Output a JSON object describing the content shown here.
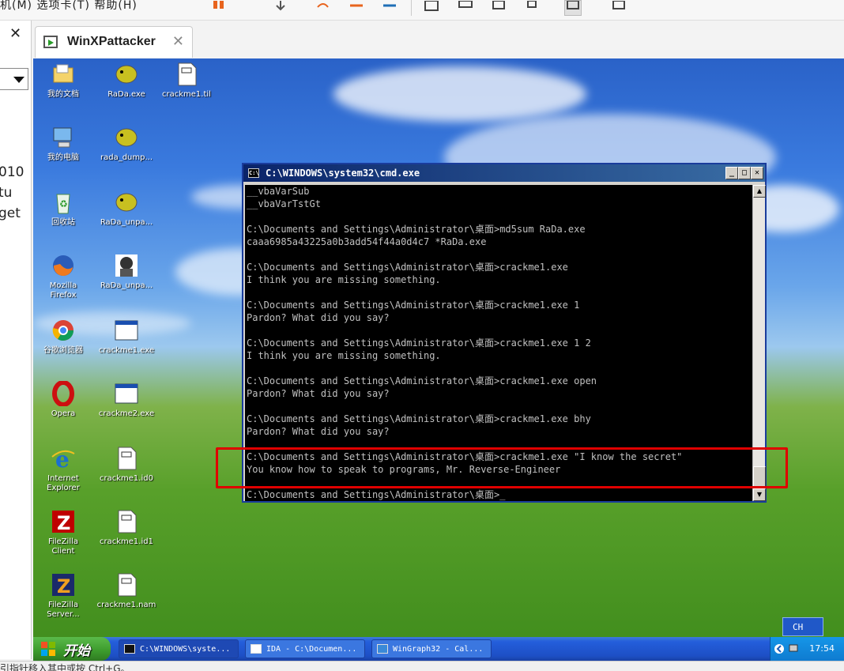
{
  "host": {
    "menu_text": "机(M)   选项卡(T)   帮助(H)",
    "clipped_side_text": [
      "010",
      "tu",
      "get"
    ],
    "bottom_text": "引指针移入其中或按 Ctrl+G。"
  },
  "vm_tab": {
    "label": "WinXPattacker"
  },
  "desktop_icons": [
    {
      "label": "我的文档",
      "icon": "my-documents-icon"
    },
    {
      "label": "RaDa.exe",
      "icon": "pufferfish-icon"
    },
    {
      "label": "crackme1.til",
      "icon": "file-icon"
    },
    {
      "label": "我的电脑",
      "icon": "my-computer-icon"
    },
    {
      "label": "rada_dump...",
      "icon": "pufferfish-icon"
    },
    {
      "label": "回收站",
      "icon": "recycle-bin-icon"
    },
    {
      "label": "RaDa_unpa...",
      "icon": "pufferfish-icon"
    },
    {
      "label": "Mozilla\nFirefox",
      "icon": "firefox-icon"
    },
    {
      "label": "RaDa_unpa...",
      "icon": "ida-portrait-icon"
    },
    {
      "label": "谷歌浏览器",
      "icon": "chrome-icon"
    },
    {
      "label": "crackme1.exe",
      "icon": "window-app-icon"
    },
    {
      "label": "Opera",
      "icon": "opera-icon"
    },
    {
      "label": "crackme2.exe",
      "icon": "window-app-icon"
    },
    {
      "label": "Internet\nExplorer",
      "icon": "ie-icon"
    },
    {
      "label": "crackme1.id0",
      "icon": "file-icon"
    },
    {
      "label": "FileZilla\nClient",
      "icon": "filezilla-icon"
    },
    {
      "label": "crackme1.id1",
      "icon": "file-icon"
    },
    {
      "label": "FileZilla\nServer...",
      "icon": "filezilla-server-icon"
    },
    {
      "label": "crackme1.nam",
      "icon": "file-icon"
    }
  ],
  "cmd": {
    "title": "C:\\WINDOWS\\system32\\cmd.exe",
    "lines": [
      "__vbaVarSub",
      "__vbaVarTstGt",
      "",
      "C:\\Documents and Settings\\Administrator\\桌面>md5sum RaDa.exe",
      "caaa6985a43225a0b3add54f44a0d4c7 *RaDa.exe",
      "",
      "C:\\Documents and Settings\\Administrator\\桌面>crackme1.exe",
      "I think you are missing something.",
      "",
      "C:\\Documents and Settings\\Administrator\\桌面>crackme1.exe 1",
      "Pardon? What did you say?",
      "",
      "C:\\Documents and Settings\\Administrator\\桌面>crackme1.exe 1 2",
      "I think you are missing something.",
      "",
      "C:\\Documents and Settings\\Administrator\\桌面>crackme1.exe open",
      "Pardon? What did you say?",
      "",
      "C:\\Documents and Settings\\Administrator\\桌面>crackme1.exe bhy",
      "Pardon? What did you say?",
      "",
      "C:\\Documents and Settings\\Administrator\\桌面>crackme1.exe \"I know the secret\"",
      "You know how to speak to programs, Mr. Reverse-Engineer",
      "",
      "C:\\Documents and Settings\\Administrator\\桌面>_"
    ]
  },
  "taskbar": {
    "start_label": "开始",
    "tasks": [
      {
        "label": "C:\\WINDOWS\\syste...",
        "icon": "cmd-icon"
      },
      {
        "label": "IDA - C:\\Documen...",
        "icon": "ida-icon"
      },
      {
        "label": "WinGraph32 - Cal...",
        "icon": "wingraph-icon"
      }
    ],
    "lang": "CH",
    "clock": "17:54"
  },
  "colors": {
    "highlight": "#e00000",
    "console_bg": "#000000",
    "console_fg": "#c0c0c0"
  }
}
